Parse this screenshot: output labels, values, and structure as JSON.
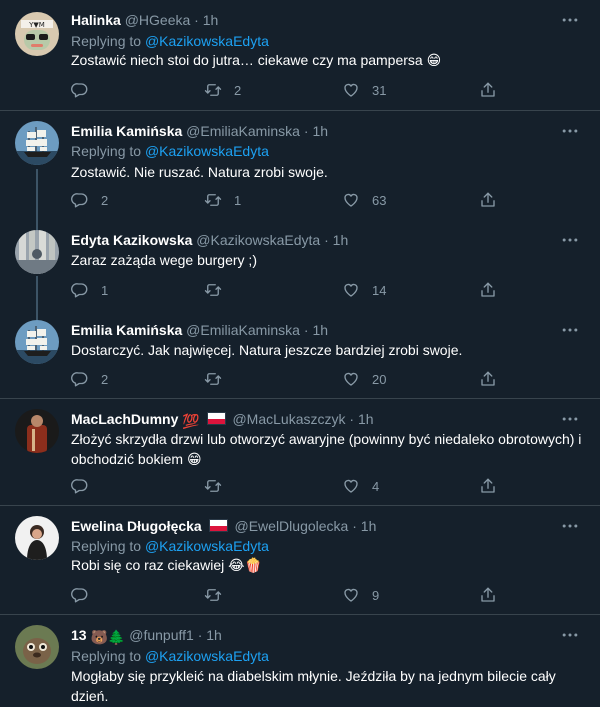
{
  "tweets": [
    {
      "name": "Halinka",
      "handle": "@HGeeka",
      "sep": "·",
      "time": "1h",
      "replying_label": "Replying to",
      "replying_to": "@KazikowskaEdyta",
      "text": "Zostawić niech stoi do jutra… ciekawe czy ma pampersa 😁",
      "replies": "",
      "retweets": "2",
      "likes": "31"
    },
    {
      "name": "Emilia Kamińska",
      "handle": "@EmiliaKaminska",
      "sep": "·",
      "time": "1h",
      "replying_label": "Replying to",
      "replying_to": "@KazikowskaEdyta",
      "text": "Zostawić. Nie ruszać. Natura zrobi swoje.",
      "replies": "2",
      "retweets": "1",
      "likes": "63"
    },
    {
      "name": "Edyta Kazikowska",
      "handle": "@KazikowskaEdyta",
      "sep": "·",
      "time": "1h",
      "text": "Zaraz zażąda wege burgery ;)",
      "replies": "1",
      "retweets": "",
      "likes": "14"
    },
    {
      "name": "Emilia Kamińska",
      "handle": "@EmiliaKaminska",
      "sep": "·",
      "time": "1h",
      "text": "Dostarczyć. Jak najwięcej. Natura jeszcze bardziej zrobi swoje.",
      "replies": "2",
      "retweets": "",
      "likes": "20"
    },
    {
      "name": "MacLachDumny",
      "name_emoji": "💯",
      "handle": "@MacLukaszczyk",
      "sep": "·",
      "time": "1h",
      "text": "Złożyć skrzydła drzwi lub otworzyć awaryjne (powinny być niedaleko obrotowych) i obchodzić bokiem 😁",
      "replies": "",
      "retweets": "",
      "likes": "4"
    },
    {
      "name": "Ewelina Długołęcka",
      "handle": "@EwelDlugolecka",
      "sep": "·",
      "time": "1h",
      "replying_label": "Replying to",
      "replying_to": "@KazikowskaEdyta",
      "text": "Robi się co raz ciekawiej 😂🍿",
      "replies": "",
      "retweets": "",
      "likes": "9"
    },
    {
      "name": "13",
      "name_emoji": "🐻🌲",
      "handle": "@funpuff1",
      "sep": "·",
      "time": "1h",
      "replying_label": "Replying to",
      "replying_to": "@KazikowskaEdyta",
      "text": "Mogłaby się przykleić na diabelskim młynie. Jeździła by na jednym bilecie cały dzień."
    }
  ],
  "colors": {
    "background": "#15202b",
    "divider": "#38444d",
    "secondary_text": "#8899a6",
    "link": "#1da1f2",
    "thread_line": "#3d5466"
  },
  "icons": [
    "reply-icon",
    "retweet-icon",
    "like-icon",
    "share-icon",
    "more-icon",
    "poland-flag-icon"
  ]
}
